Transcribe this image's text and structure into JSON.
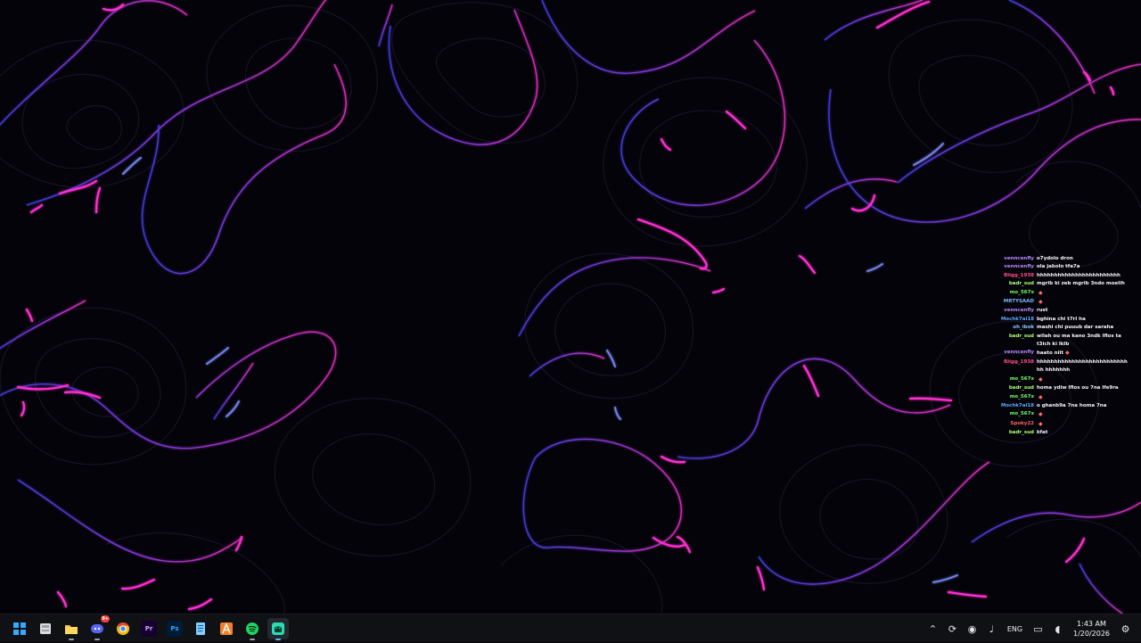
{
  "chat": {
    "messages": [
      {
        "user": "venncenfly",
        "text": "o7ydolo dron",
        "user_color": "#b989ff",
        "user_icon": "none"
      },
      {
        "user": "venncenfly",
        "text": "ola jabolo tfa7a",
        "user_color": "#b989ff",
        "user_icon": "none"
      },
      {
        "user": "Biigg_1938",
        "text": "hhhhhhhhhhhhhhhhhhhhhhhh",
        "user_color": "#ff4b91",
        "user_icon": "none"
      },
      {
        "user": "badr_sud",
        "text": "mgrib ki zeb mgrib 3ndo moelih",
        "user_color": "#a9ff6f",
        "user_icon": "none"
      },
      {
        "user": "mo_567x",
        "text": "",
        "user_color": "#72ff64",
        "user_icon": "emote-icon"
      },
      {
        "user": "MRTYSAAD",
        "text": "",
        "user_color": "#77b7ff",
        "user_icon": "emote-icon"
      },
      {
        "user": "venncenfly",
        "text": "rust",
        "user_color": "#b989ff",
        "user_icon": "none"
      },
      {
        "user": "Mochk7al18",
        "text": "bghina chi t7rl ha",
        "user_color": "#5aa8ff",
        "user_icon": "none"
      },
      {
        "user": "oh_ibok",
        "text": "mashi chi puuub dar saraha",
        "user_color": "#8cc9ff",
        "user_icon": "none"
      },
      {
        "user": "badr_sud",
        "text": "wllah ou ma kano 3ndk lflos ta t3ich ki lklb",
        "user_color": "#a9ff6f",
        "user_icon": "none"
      },
      {
        "user": "venncenfly",
        "text": "haato niit",
        "user_color": "#b989ff",
        "user_icon": "emote-icon"
      },
      {
        "user": "Biigg_1938",
        "text": "hhhhhhhhhhhhhhhhhhhhhhhhhhhh hhhhhhh",
        "user_color": "#ff4b91",
        "user_icon": "none"
      },
      {
        "user": "mo_567x",
        "text": "",
        "user_color": "#72ff64",
        "user_icon": "emote-icon"
      },
      {
        "user": "badr_sud",
        "text": "homa ydiw lflos ou 7na lfe9ra",
        "user_color": "#a9ff6f",
        "user_icon": "none"
      },
      {
        "user": "mo_567x",
        "text": "",
        "user_color": "#72ff64",
        "user_icon": "emote-icon"
      },
      {
        "user": "Mochk7al18",
        "text": "o ghanb9a 7na homa 7na",
        "user_color": "#5aa8ff",
        "user_icon": "none"
      },
      {
        "user": "mo_567x",
        "text": "",
        "user_color": "#72ff64",
        "user_icon": "emote-icon"
      },
      {
        "user": "Spoky22",
        "text": "",
        "user_color": "#ff6464",
        "user_icon": "emote-icon"
      },
      {
        "user": "badr_sud",
        "text": "kfat",
        "user_color": "#a9ff6f",
        "user_icon": "none"
      }
    ]
  },
  "taskbar": {
    "apps": [
      {
        "name": "Start",
        "icon": "windows-logo-icon",
        "badge": ""
      },
      {
        "name": "File Explorer",
        "icon": "file-explorer-icon",
        "badge": ""
      },
      {
        "name": "Folder",
        "icon": "folder-icon",
        "badge": ""
      },
      {
        "name": "Discord",
        "icon": "discord-icon",
        "badge": "9+"
      },
      {
        "name": "Chrome",
        "icon": "chrome-icon",
        "badge": ""
      },
      {
        "name": "Premiere Pro",
        "icon": "premiere-pro-icon",
        "label": "Pr",
        "badge": ""
      },
      {
        "name": "Photoshop",
        "icon": "photoshop-icon",
        "label": "Ps",
        "badge": ""
      },
      {
        "name": "Notepad",
        "icon": "notepad-icon",
        "badge": ""
      },
      {
        "name": "Application",
        "icon": "orange-a-icon",
        "badge": ""
      },
      {
        "name": "Spotify",
        "icon": "spotify-icon",
        "badge": ""
      },
      {
        "name": "Android Emulator",
        "icon": "android-app-icon",
        "badge": ""
      }
    ],
    "tray": {
      "language": "ENG",
      "time": "1:43 AM",
      "date": "1/20/2026",
      "icons": [
        "chevron-up-icon",
        "sync-icon",
        "record-icon",
        "microphone-icon",
        "display-icon",
        "volume-icon",
        "settings-icon"
      ]
    }
  },
  "colors": {
    "desktop_background": "#040309",
    "contour_dark": "#17162b",
    "contour_blue": "#6a5cff",
    "contour_pink": "#ff35cf",
    "taskbar_background": "#0f1115"
  }
}
